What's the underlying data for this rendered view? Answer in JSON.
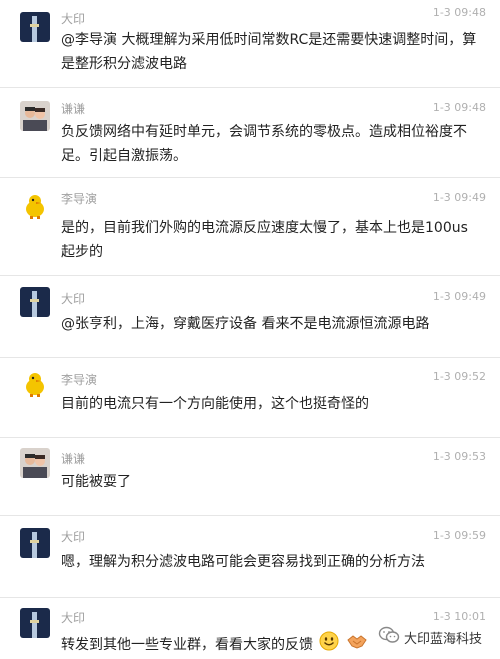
{
  "messages": [
    {
      "name": "大印",
      "time": "1-3 09:48",
      "text": "@李导演 大概理解为采用低时间常数RC是还需要快速调整时间，算是整形积分滤波电路"
    },
    {
      "name": "谦谦",
      "time": "1-3 09:48",
      "text": "负反馈网络中有延时单元，会调节系统的零极点。造成相位裕度不足。引起自激振荡。"
    },
    {
      "name": "李导演",
      "time": "1-3 09:49",
      "text": "是的，目前我们外购的电流源反应速度太慢了，基本上也是100us起步的"
    },
    {
      "name": "大印",
      "time": "1-3 09:49",
      "text": "@张亨利，上海，穿戴医疗设备 看来不是电流源恒流源电路"
    },
    {
      "name": "李导演",
      "time": "1-3 09:52",
      "text": "目前的电流只有一个方向能使用，这个也挺奇怪的"
    },
    {
      "name": "谦谦",
      "time": "1-3 09:53",
      "text": "可能被耍了"
    },
    {
      "name": "大印",
      "time": "1-3 09:59",
      "text": "嗯，理解为积分滤波电路可能会更容易找到正确的分析方法"
    },
    {
      "name": "大印",
      "time": "1-3 10:01",
      "text": "转发到其他一些专业群，看看大家的反馈"
    }
  ],
  "watermark": {
    "text": "大印蓝海科技"
  }
}
